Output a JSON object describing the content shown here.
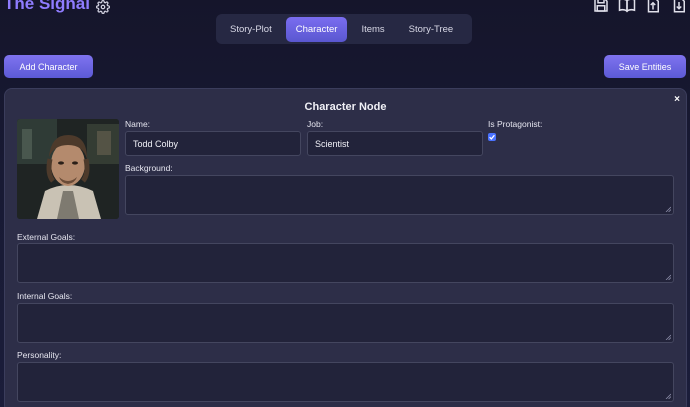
{
  "app": {
    "title": "The Signal"
  },
  "tabs": [
    {
      "label": "Story-Plot"
    },
    {
      "label": "Character"
    },
    {
      "label": "Items"
    },
    {
      "label": "Story-Tree"
    }
  ],
  "active_tab": "Character",
  "toolbar": {
    "add_label": "Add Character",
    "save_label": "Save Entities"
  },
  "panel": {
    "title": "Character Node",
    "close_glyph": "×",
    "fields": {
      "name_label": "Name:",
      "name_value": "Todd Colby",
      "job_label": "Job:",
      "job_value": "Scientist",
      "protagonist_label": "Is Protagonist:",
      "protagonist_checked": true,
      "background_label": "Background:",
      "external_label": "External Goals:",
      "internal_label": "Internal Goals:",
      "personality_label": "Personality:"
    }
  },
  "icons": [
    "gear-icon",
    "save-icon",
    "book-icon",
    "export-icon",
    "import-icon"
  ],
  "colors": {
    "accent": "#6d64e6",
    "title": "#8f7cff",
    "checkbox": "#4a72ff"
  }
}
